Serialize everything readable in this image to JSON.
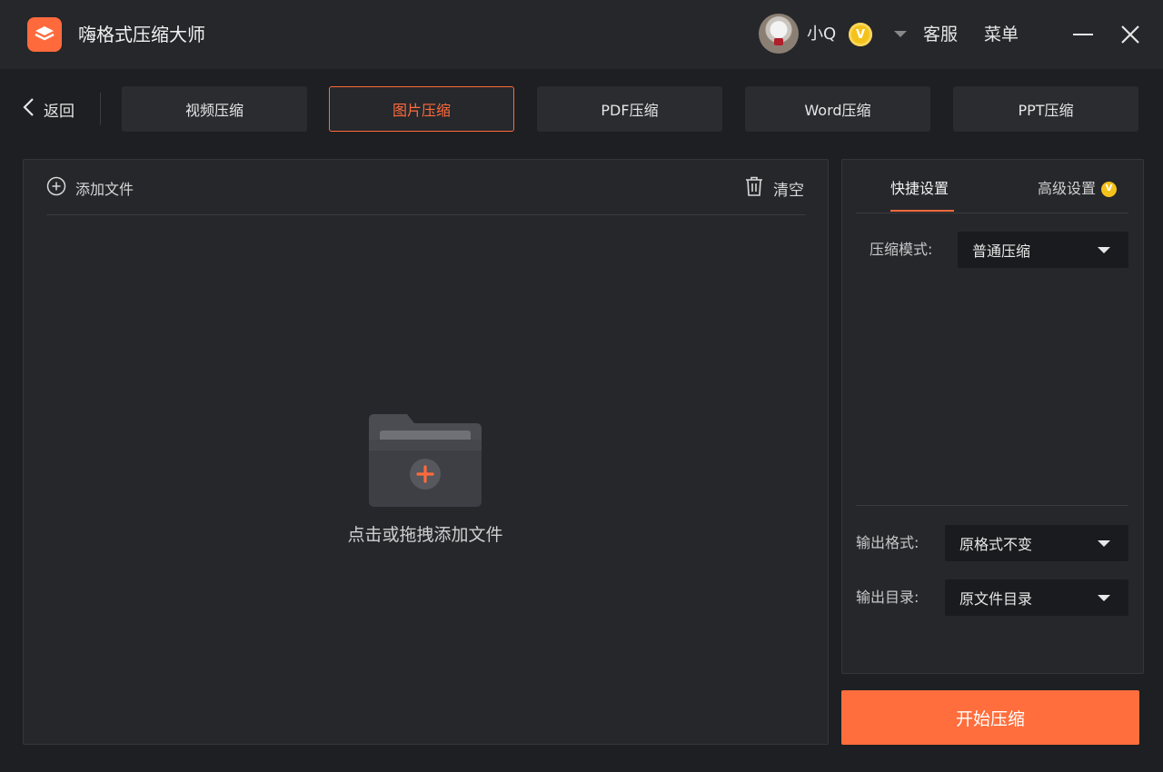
{
  "app": {
    "title": "嗨格式压缩大师",
    "user_name": "小Q",
    "vip_badge": "V",
    "service_label": "客服",
    "menu_label": "菜单"
  },
  "nav": {
    "back_label": "返回",
    "tabs": [
      {
        "label": "视频压缩",
        "active": false
      },
      {
        "label": "图片压缩",
        "active": true
      },
      {
        "label": "PDF压缩",
        "active": false
      },
      {
        "label": "Word压缩",
        "active": false
      },
      {
        "label": "PPT压缩",
        "active": false
      }
    ]
  },
  "file_panel": {
    "add_file_label": "添加文件",
    "clear_label": "清空",
    "drop_hint": "点击或拖拽添加文件"
  },
  "settings": {
    "quick_tab": "快捷设置",
    "advanced_tab": "高级设置",
    "advanced_badge": "V",
    "compress_mode_label": "压缩模式:",
    "compress_mode_value": "普通压缩",
    "output_format_label": "输出格式:",
    "output_format_value": "原格式不变",
    "output_dir_label": "输出目录:",
    "output_dir_value": "原文件目录"
  },
  "actions": {
    "start_label": "开始压缩"
  },
  "colors": {
    "accent": "#ff6a3d",
    "vip_gold": "#f5c21b",
    "background": "#1e1f22",
    "panel": "#25272b"
  },
  "icons": [
    "app-logo-icon",
    "chevron-down-icon",
    "minimize-icon",
    "close-icon",
    "chevron-left-icon",
    "add-circle-icon",
    "trash-icon",
    "folder-add-icon"
  ]
}
